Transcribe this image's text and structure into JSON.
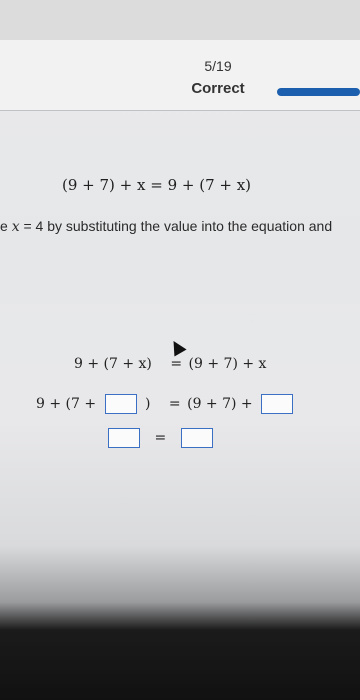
{
  "progress": {
    "count": "5/19",
    "status": "Correct"
  },
  "equation": "(9 + 7) + x = 9 + (7 + x)",
  "instruction": {
    "prefix": "e ",
    "var": "x",
    "text": " = 4 by substituting the value into the equation and"
  },
  "work": {
    "row1_left": "9 + (7 + x)",
    "row1_eq": "=",
    "row1_right": "(9 + 7) + x",
    "row2_left": "9 + (7 +",
    "row2_close": ")",
    "row2_eq": "=",
    "row2_right": "(9 + 7) +",
    "row3_eq": "="
  },
  "colors": {
    "accent": "#1b5fae",
    "box_border": "#3b6fc4"
  }
}
